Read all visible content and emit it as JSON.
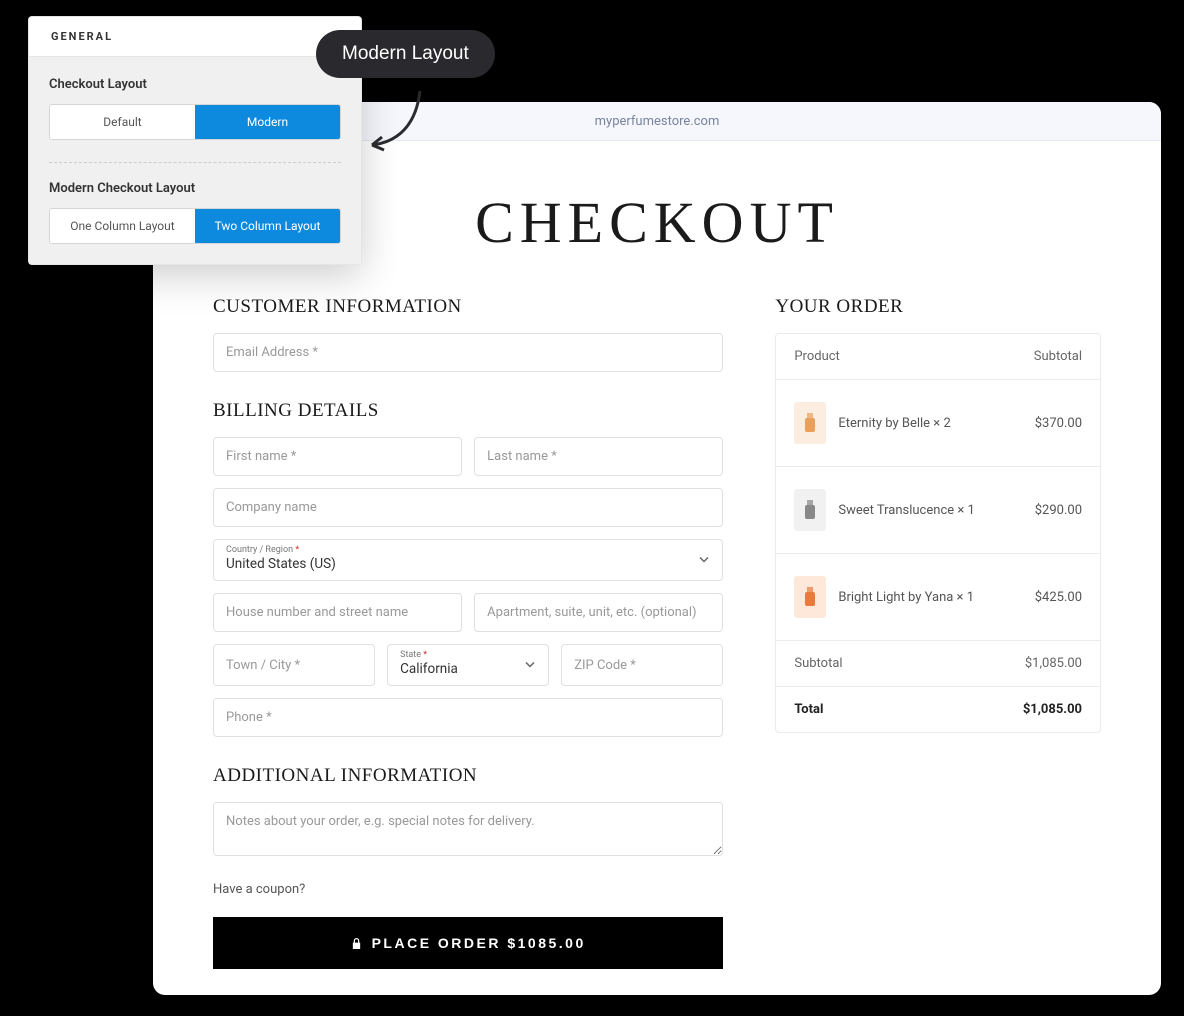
{
  "settings": {
    "tab_label": "GENERAL",
    "section1_label": "Checkout Layout",
    "seg1": {
      "opt1": "Default",
      "opt2": "Modern"
    },
    "section2_label": "Modern Checkout Layout",
    "seg2": {
      "opt1": "One Column Layout",
      "opt2": "Two Column Layout"
    }
  },
  "callout_text": "Modern Layout",
  "browser": {
    "url": "myperfumestore.com"
  },
  "page_title": "CHECKOUT",
  "customer": {
    "heading": "CUSTOMER INFORMATION",
    "email_ph": "Email Address *"
  },
  "billing": {
    "heading": "BILLING DETAILS",
    "first_ph": "First name *",
    "last_ph": "Last name *",
    "company_ph": "Company name",
    "country_lbl": "Country / Region",
    "country_val": "United States (US)",
    "street_ph": "House number and street name",
    "apt_ph": "Apartment, suite, unit, etc. (optional)",
    "city_ph": "Town / City *",
    "state_lbl": "State",
    "state_val": "California",
    "zip_ph": "ZIP Code *",
    "phone_ph": "Phone *"
  },
  "additional": {
    "heading": "ADDITIONAL INFORMATION",
    "notes_ph": "Notes about your order, e.g. special notes for delivery."
  },
  "coupon_text": "Have a coupon?",
  "place_order_text": "PLACE ORDER $1085.00",
  "order": {
    "heading": "YOUR ORDER",
    "col_product": "Product",
    "col_subtotal": "Subtotal",
    "items": [
      {
        "name": "Eternity by Belle × 2",
        "price": "$370.00",
        "color": "#fbeee0",
        "icon": "#e8a05c"
      },
      {
        "name": "Sweet Translucence × 1",
        "price": "$290.00",
        "color": "#f1f1f1",
        "icon": "#888"
      },
      {
        "name": "Bright Light by Yana × 1",
        "price": "$425.00",
        "color": "#fde8d9",
        "icon": "#e87b3c"
      }
    ],
    "subtotal_label": "Subtotal",
    "subtotal_val": "$1,085.00",
    "total_label": "Total",
    "total_val": "$1,085.00"
  }
}
